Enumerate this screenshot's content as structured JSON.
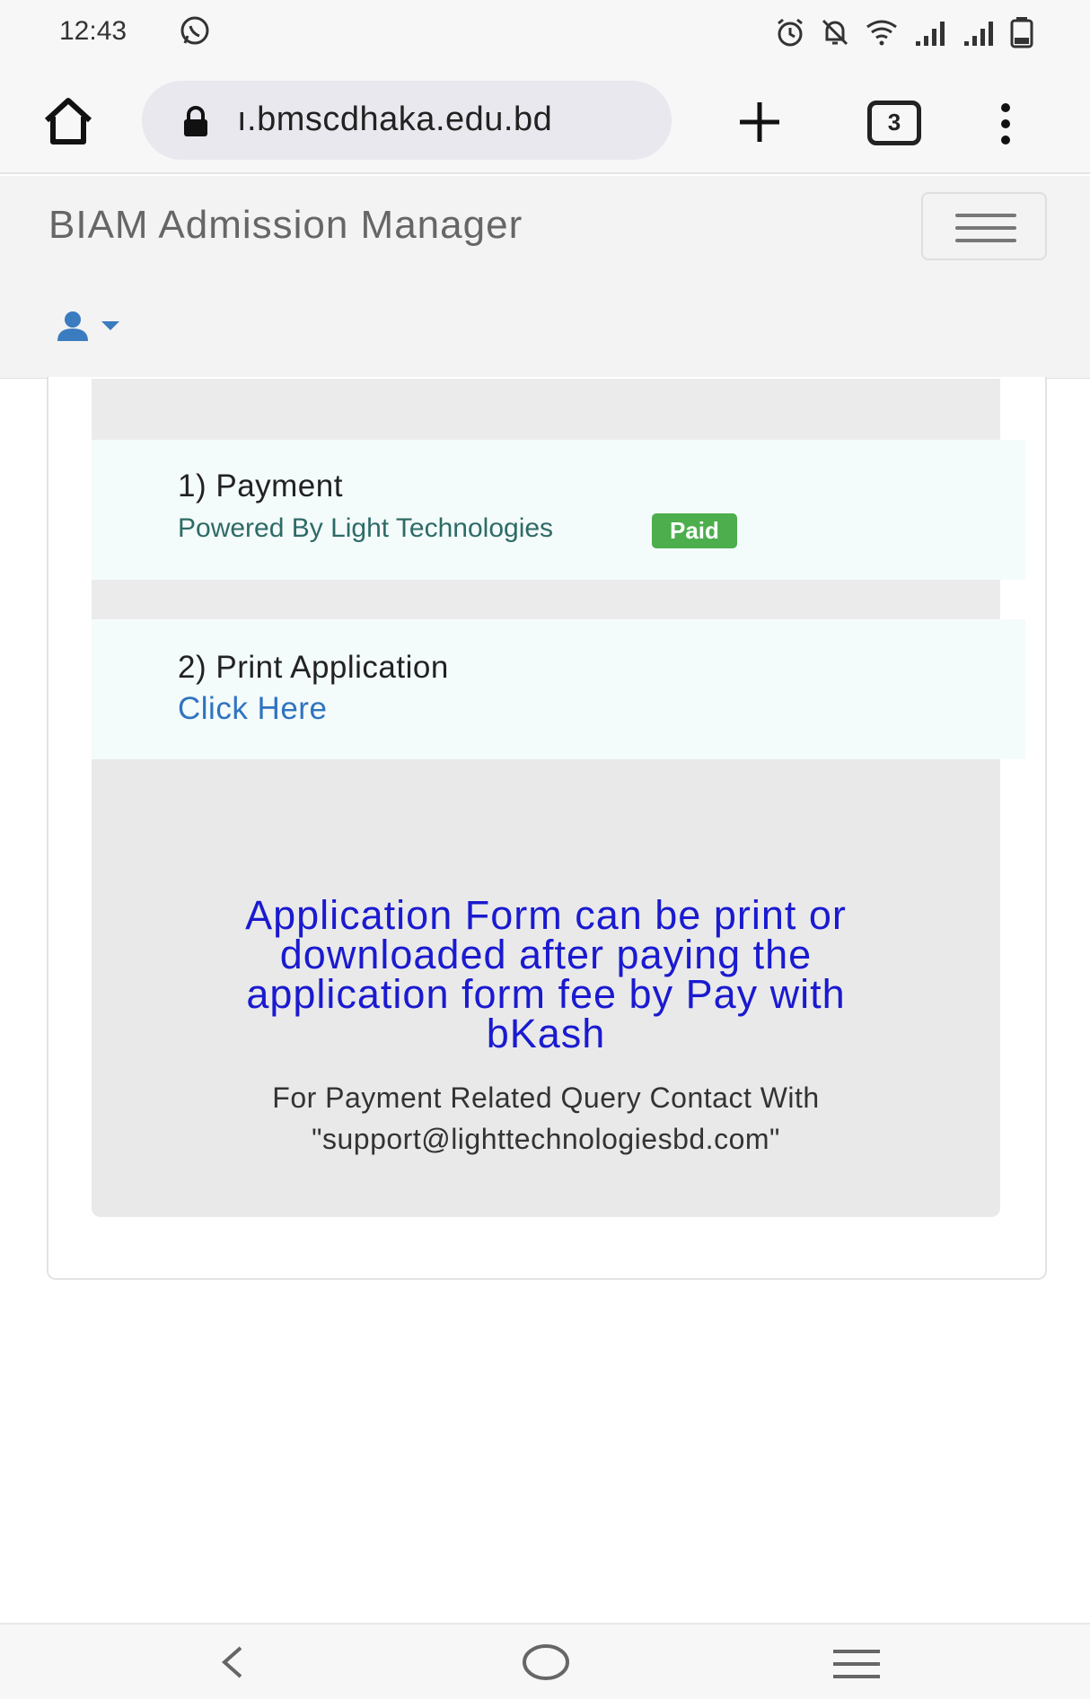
{
  "status_bar": {
    "time": "12:43",
    "icons": [
      "whatsapp-icon",
      "alarm-icon",
      "mute-icon",
      "wifi-icon",
      "signal-icon",
      "signal-icon",
      "battery-icon"
    ]
  },
  "browser": {
    "url": "ı.bmscdhaka.edu.bd",
    "tab_count": "3"
  },
  "navbar": {
    "brand": "BIAM Admission Manager"
  },
  "steps": {
    "payment": {
      "title": "1) Payment",
      "powered_by": "Powered By Light Technologies",
      "status_badge": "Paid"
    },
    "print": {
      "title": "2) Print Application",
      "link": "Click Here"
    }
  },
  "notice": {
    "main_lines": [
      "Application Form can be print or",
      "downloaded after paying the",
      "application form fee by Pay with",
      "bKash"
    ],
    "sub_lines": [
      "For Payment Related Query Contact With",
      "\"support@lighttechnologiesbd.com\""
    ]
  },
  "colors": {
    "badge_green": "#4cae4c",
    "link_blue": "#2f74c0",
    "notice_blue": "#1a1ad0",
    "user_icon_blue": "#3b7bc0"
  }
}
